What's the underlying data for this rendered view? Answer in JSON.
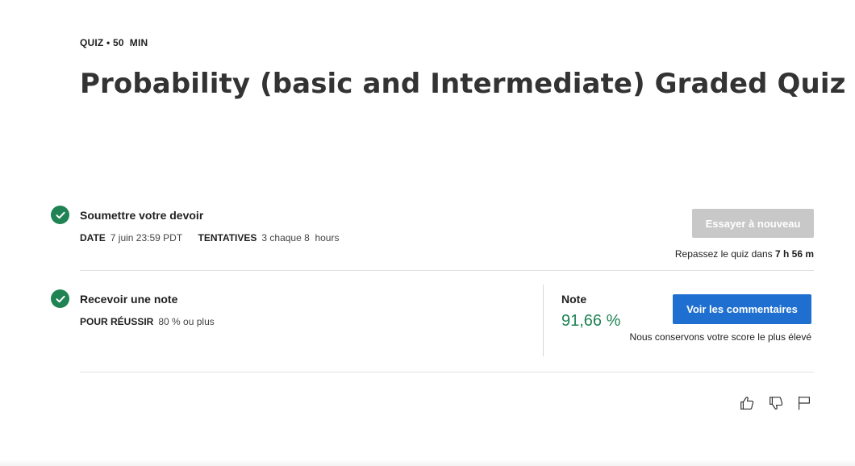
{
  "header": {
    "type_label": "QUIZ",
    "separator": "•",
    "duration": "50  MIN",
    "title": "Probability (basic and Intermediate) Graded Quiz"
  },
  "submit_step": {
    "title": "Soumettre votre devoir",
    "due_label": "DATE",
    "due_value": "7 juin 23:59 PDT",
    "attempts_label": "TENTATIVES",
    "attempts_value": "3 chaque 8  hours",
    "retry_button": "Essayer à nouveau",
    "retry_note_prefix": "Repassez le quiz dans",
    "retry_note_time": "7 h 56 m"
  },
  "grade_step": {
    "title": "Recevoir une note",
    "pass_label": "POUR RÉUSSIR",
    "pass_value": "80 % ou plus",
    "grade_label": "Note",
    "grade_value": "91,66 %",
    "feedback_button": "Voir les commentaires",
    "keep_note": "Nous conservons votre score le plus élevé"
  },
  "feedback_icons": [
    "like-icon",
    "dislike-icon",
    "flag-icon"
  ],
  "colors": {
    "success": "#1f8354",
    "primary": "#1f6fd1",
    "disabled": "#c8c8c8"
  }
}
